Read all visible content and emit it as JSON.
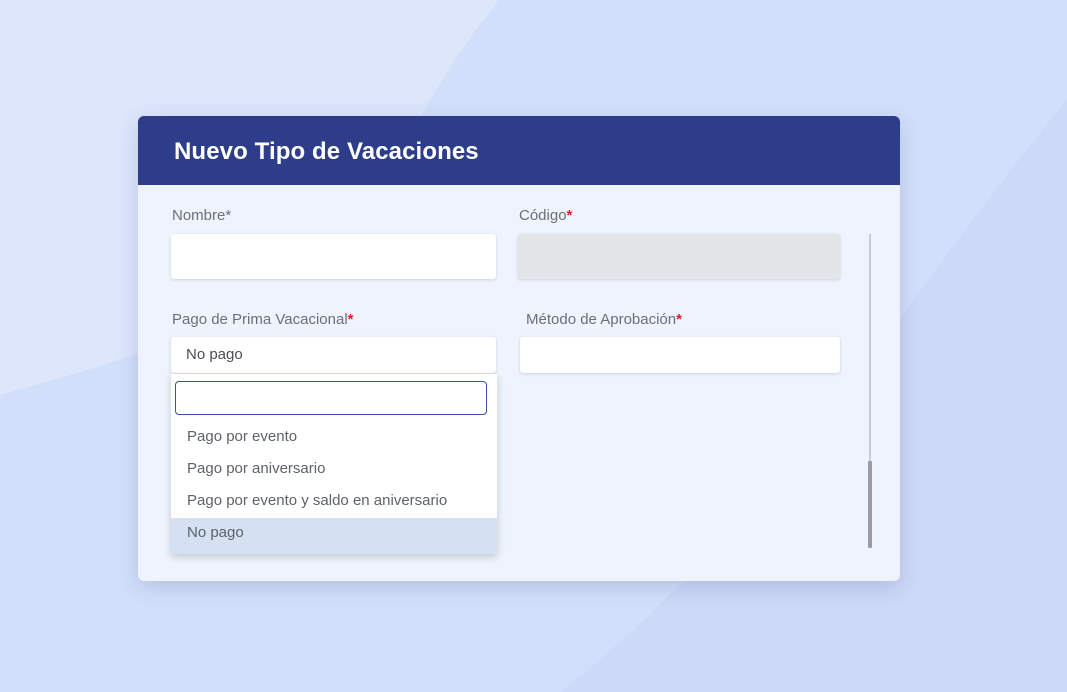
{
  "modal": {
    "title": "Nuevo Tipo de Vacaciones"
  },
  "form": {
    "nombre": {
      "label": "Nombre*",
      "value": ""
    },
    "codigo": {
      "label": "Código",
      "required_mark": "*",
      "value": ""
    },
    "prima": {
      "label": "Pago de Prima Vacacional",
      "required_mark": "*",
      "selected_value": "No pago",
      "search_value": "",
      "options": [
        "Pago por evento",
        "Pago por aniversario",
        "Pago por evento y saldo en aniversario",
        "No pago"
      ],
      "selected_index": 3
    },
    "metodo": {
      "label": "Método de Aprobación",
      "required_mark": "*",
      "value": ""
    }
  },
  "colors": {
    "header": "#2d3d89",
    "required": "#d81e2c",
    "selected_option": "#d5e0f1",
    "search_border": "#3453a4"
  }
}
